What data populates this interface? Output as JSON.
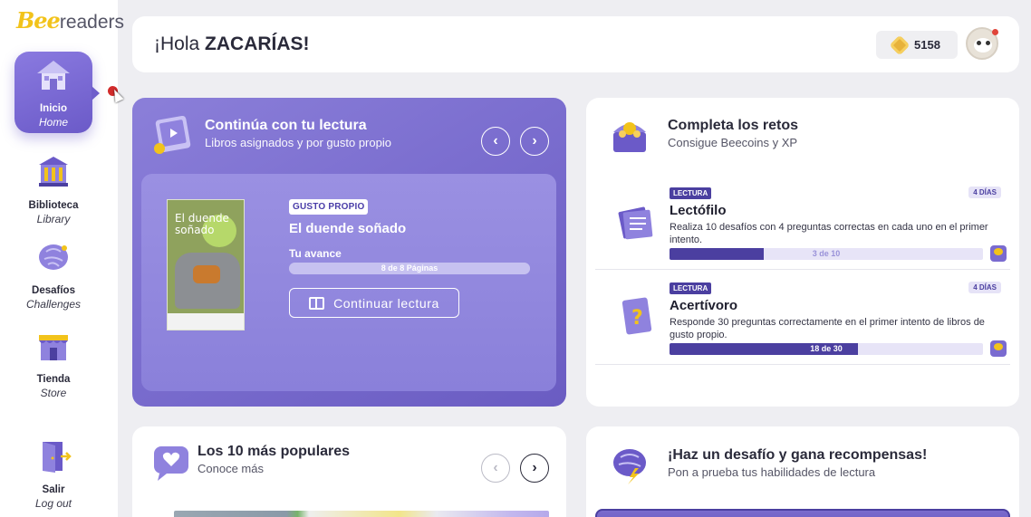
{
  "logo": {
    "bee": "Bee",
    "readers": "readers"
  },
  "sidebar": {
    "items": [
      {
        "label": "Inicio",
        "sublabel": "Home",
        "icon": "house-icon",
        "active": true
      },
      {
        "label": "Biblioteca",
        "sublabel": "Library",
        "icon": "library-icon"
      },
      {
        "label": "Desafíos",
        "sublabel": "Challenges",
        "icon": "brain-icon"
      },
      {
        "label": "Tienda",
        "sublabel": "Store",
        "icon": "store-icon"
      },
      {
        "label": "Salir",
        "sublabel": "Log out",
        "icon": "logout-door-icon"
      }
    ]
  },
  "header": {
    "greeting_prefix": "¡Hola ",
    "greeting_name": "ZACARÍAS!",
    "coins": "5158",
    "coin_icon": "beecoin-icon",
    "avatar_icon": "panda-avatar-icon"
  },
  "reading": {
    "title": "Continúa con tu lectura",
    "subtitle": "Libros asignados y por gusto propio",
    "prev_icon": "chevron-left-icon",
    "next_icon": "chevron-right-icon",
    "cover_title": "El duende soñado",
    "tag": "GUSTO PROPIO",
    "book_title": "El duende soñado",
    "progress_label": "Tu avance",
    "progress_text": "8 de 8 Páginas",
    "progress_fraction": 1.0,
    "button_label": "Continuar lectura"
  },
  "challenges": {
    "title": "Completa los retos",
    "subtitle": "Consigue Beecoins y XP",
    "items": [
      {
        "tag": "LECTURA",
        "days": "4 DÍAS",
        "name": "Lectófilo",
        "desc": "Realiza 10 desafíos con 4 preguntas correctas en cada uno en el primer intento.",
        "progress_text": "3 de 10",
        "progress_fraction": 0.3
      },
      {
        "tag": "LECTURA",
        "days": "4 DÍAS",
        "name": "Acertívoro",
        "desc": "Responde 30 preguntas correctamente en el primer intento de libros de gusto propio.",
        "progress_text": "18 de 30",
        "progress_fraction": 0.6
      }
    ]
  },
  "popular": {
    "title": "Los 10 más populares",
    "subtitle": "Conoce más"
  },
  "reward": {
    "title": "¡Haz un desafío y gana recompensas!",
    "subtitle": "Pon a prueba tus habilidades de lectura"
  },
  "colors": {
    "accent": "#6b5ac8",
    "dark_accent": "#4b3fa0",
    "gold": "#f2c31b"
  }
}
